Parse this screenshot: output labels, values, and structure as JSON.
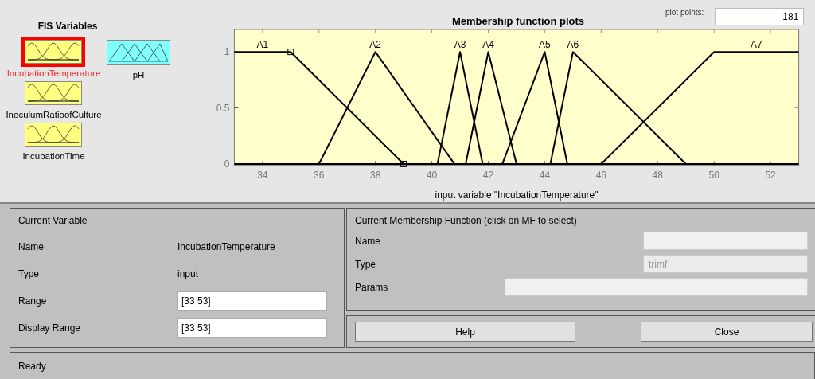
{
  "fis_variables": {
    "title": "FIS Variables",
    "inputs": [
      {
        "name": "IncubationTemperature",
        "selected": true
      },
      {
        "name": "InoculumRatioofCulture",
        "selected": false
      },
      {
        "name": "IncubationTime",
        "selected": false
      }
    ],
    "outputs": [
      {
        "name": "pH",
        "selected": false
      }
    ]
  },
  "plot": {
    "title": "Membership function plots",
    "plot_points_label": "plot points:",
    "plot_points": "181",
    "chart_data": {
      "type": "line",
      "xlabel": "input variable \"IncubationTemperature\"",
      "xlim": [
        33,
        53
      ],
      "ylim": [
        -0.01,
        1.2
      ],
      "xticks": [
        34,
        36,
        38,
        40,
        42,
        44,
        46,
        48,
        50,
        52
      ],
      "yticks": [
        0,
        0.5,
        1
      ],
      "series": [
        {
          "name": "A1",
          "color": "#000000",
          "x": [
            33,
            35,
            39
          ],
          "values": [
            1,
            1,
            0
          ]
        },
        {
          "name": "A2",
          "color": "#000000",
          "x": [
            36,
            38,
            40.8
          ],
          "values": [
            0,
            1,
            0
          ]
        },
        {
          "name": "A3",
          "color": "#000000",
          "x": [
            40.2,
            41,
            41.8
          ],
          "values": [
            0,
            1,
            0
          ]
        },
        {
          "name": "A4",
          "color": "#000000",
          "x": [
            41.2,
            42,
            43
          ],
          "values": [
            0,
            1,
            0
          ]
        },
        {
          "name": "A5",
          "color": "#000000",
          "x": [
            42.5,
            44,
            44.8
          ],
          "values": [
            0,
            1,
            0
          ]
        },
        {
          "name": "A6",
          "color": "#000000",
          "x": [
            44.2,
            45,
            49
          ],
          "values": [
            0,
            1,
            0
          ]
        },
        {
          "name": "A7",
          "color": "#000000",
          "x": [
            46,
            50,
            53
          ],
          "values": [
            0,
            1,
            1
          ]
        }
      ]
    },
    "mfs": [
      {
        "selected": true
      },
      {
        "selected": false
      },
      {
        "selected": false
      },
      {
        "selected": false
      },
      {
        "selected": false
      },
      {
        "selected": false
      },
      {
        "selected": false
      }
    ]
  },
  "current_variable": {
    "title": "Current Variable",
    "name_label": "Name",
    "name": "IncubationTemperature",
    "type_label": "Type",
    "type": "input",
    "range_label": "Range",
    "range": "[33 53]",
    "display_range_label": "Display Range",
    "display_range": "[33 53]"
  },
  "current_mf": {
    "title": "Current Membership Function (click on MF to select)",
    "name_label": "Name",
    "type_label": "Type",
    "type": "trimf",
    "type_disabled": true,
    "params_label": "Params"
  },
  "buttons": [
    "Help",
    "Close"
  ],
  "status": "Ready"
}
